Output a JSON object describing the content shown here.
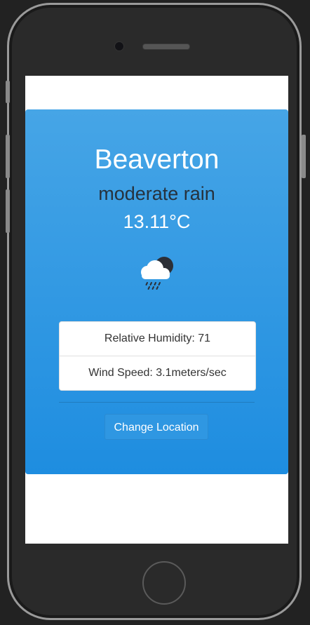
{
  "weather": {
    "city": "Beaverton",
    "condition": "moderate rain",
    "temperature": "13.11°C",
    "icon": "rain-cloud-night-icon",
    "humidity_label": "Relative Humidity: 71",
    "wind_label": "Wind Speed: 3.1meters/sec"
  },
  "actions": {
    "change_location_label": "Change Location"
  },
  "colors": {
    "card_top": "#46a5e6",
    "card_bottom": "#1e8de0",
    "condition_text": "#26323e"
  }
}
